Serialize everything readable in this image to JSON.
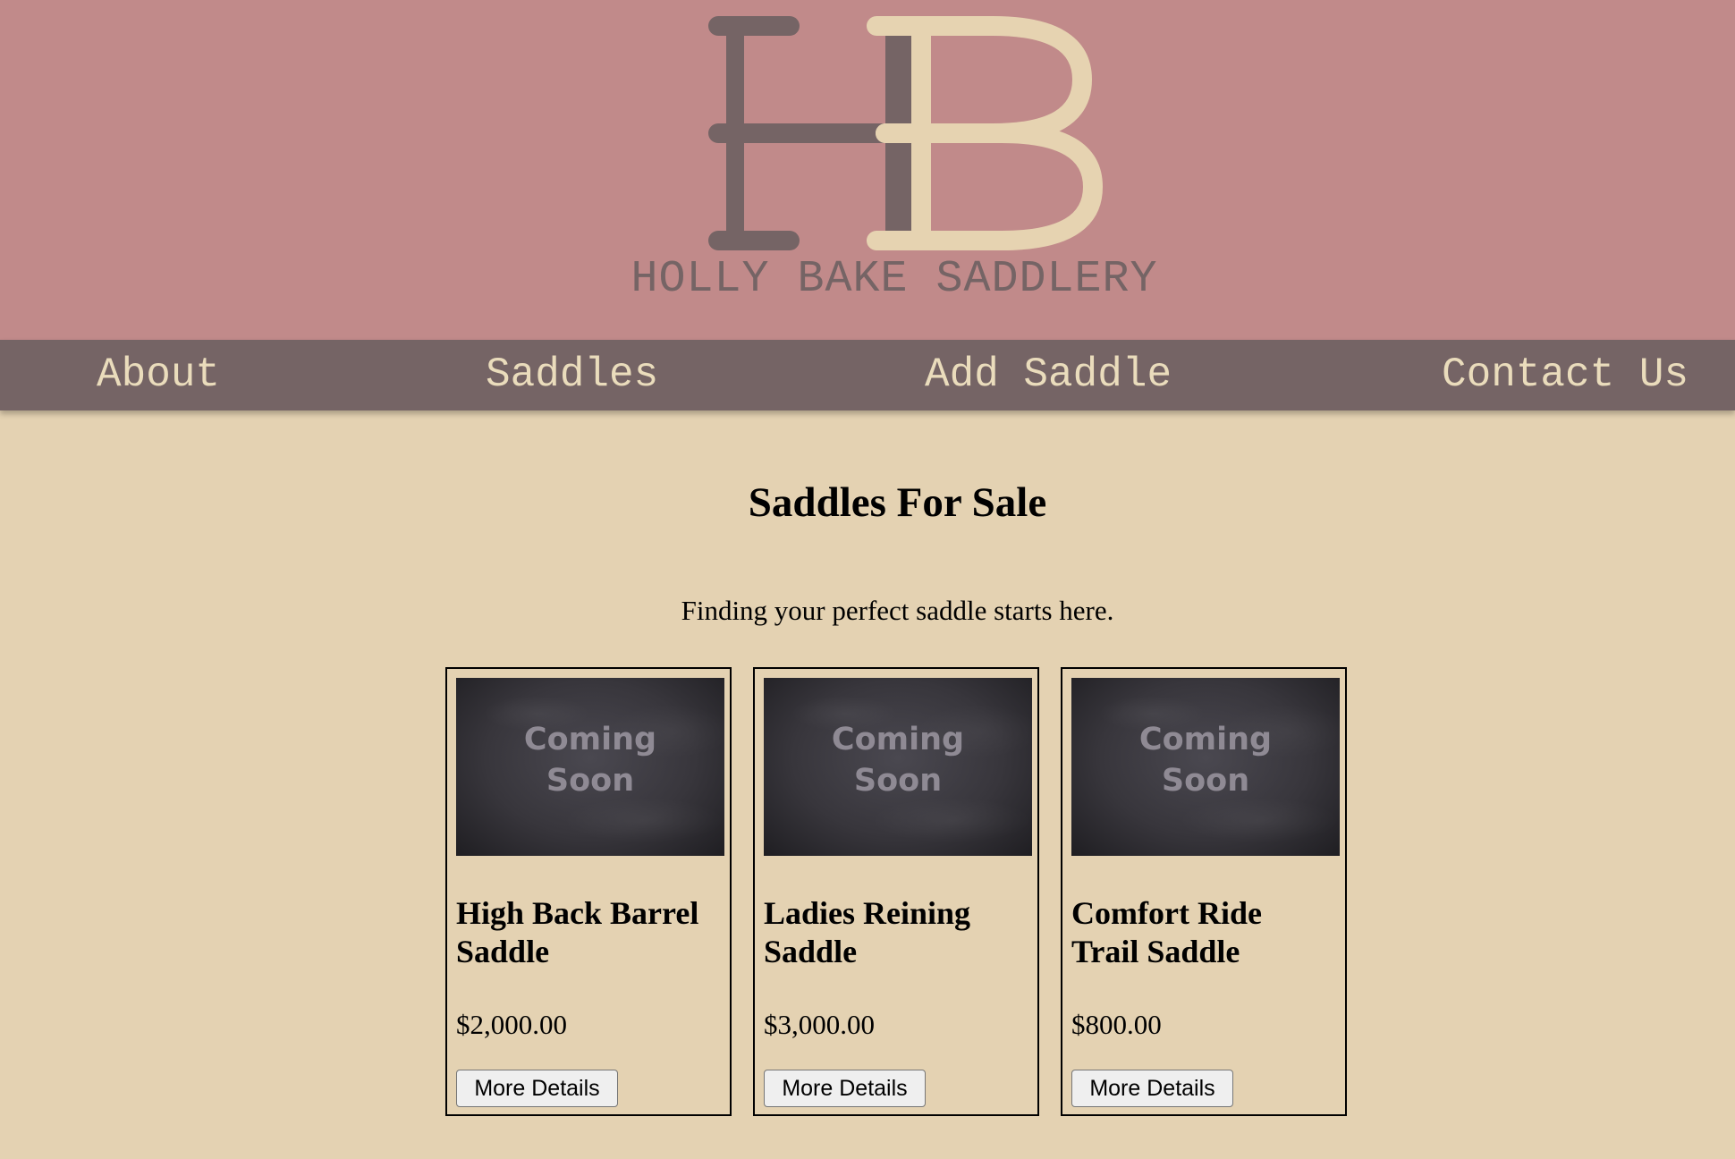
{
  "brand": {
    "monogram_left": "H",
    "monogram_right": "B",
    "name": "HOLLY BAKE SADDLERY",
    "colors": {
      "banner": "#c18a8a",
      "monogram_dark": "#756465",
      "monogram_light": "#e6d3b1",
      "page_background": "#e4d2b2"
    }
  },
  "nav": {
    "items": [
      {
        "label": "About"
      },
      {
        "label": "Saddles"
      },
      {
        "label": "Add Saddle"
      },
      {
        "label": "Contact Us"
      }
    ]
  },
  "main": {
    "title": "Saddles For Sale",
    "intro": "Finding your perfect saddle starts here."
  },
  "products": [
    {
      "image_text_line1": "Coming",
      "image_text_line2": "Soon",
      "name_line1": "High Back Barrel",
      "name_line2": "Saddle",
      "price": "$2,000.00",
      "button_label": "More Details"
    },
    {
      "image_text_line1": "Coming",
      "image_text_line2": "Soon",
      "name_line1": "Ladies Reining",
      "name_line2": "Saddle",
      "price": "$3,000.00",
      "button_label": "More Details"
    },
    {
      "image_text_line1": "Coming",
      "image_text_line2": "Soon",
      "name_line1": "Comfort Ride",
      "name_line2": "Trail Saddle",
      "price": "$800.00",
      "button_label": "More Details"
    }
  ]
}
